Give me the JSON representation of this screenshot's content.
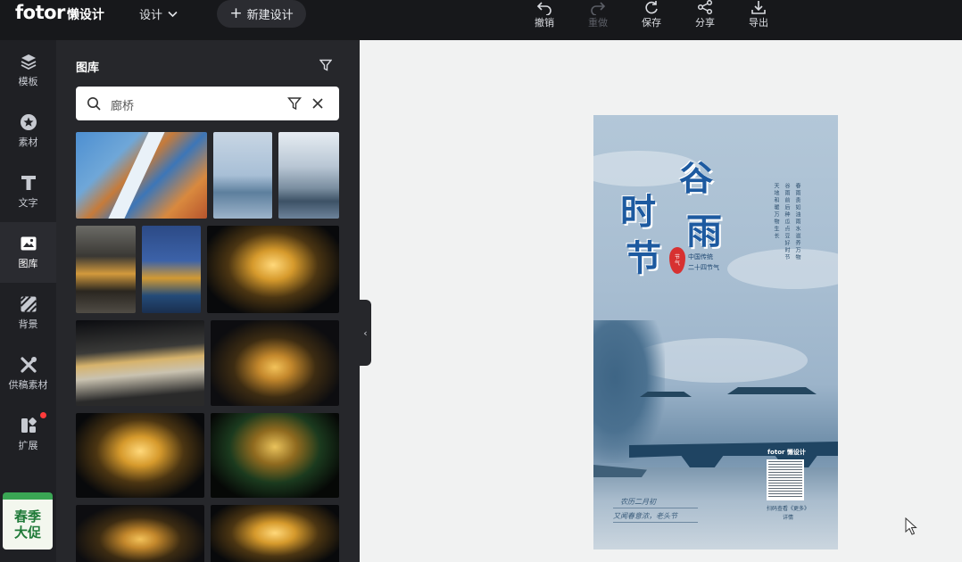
{
  "app": {
    "brand": "fotor",
    "product": "懒设计"
  },
  "header": {
    "design_menu": "设计",
    "new_design": "新建设计",
    "tools": [
      {
        "label": "撤销",
        "icon": "undo-icon",
        "enabled": true
      },
      {
        "label": "重做",
        "icon": "redo-icon",
        "enabled": false
      },
      {
        "label": "保存",
        "icon": "save-icon",
        "enabled": true
      },
      {
        "label": "分享",
        "icon": "share-icon",
        "enabled": true
      },
      {
        "label": "导出",
        "icon": "export-icon",
        "enabled": true
      }
    ]
  },
  "rail": {
    "items": [
      {
        "label": "模板",
        "icon": "layers-icon"
      },
      {
        "label": "素材",
        "icon": "star-icon"
      },
      {
        "label": "文字",
        "icon": "text-icon"
      },
      {
        "label": "图库",
        "icon": "image-icon",
        "active": true
      },
      {
        "label": "背景",
        "icon": "background-icon"
      },
      {
        "label": "供稿素材",
        "icon": "tools-icon"
      },
      {
        "label": "扩展",
        "icon": "extension-icon",
        "badge": true
      }
    ],
    "promo": {
      "line1": "春季",
      "line2": "大促"
    }
  },
  "panel": {
    "title": "图库",
    "search": {
      "value": "廊桥"
    }
  },
  "poster": {
    "title_chars": [
      "谷",
      "雨",
      "时",
      "节"
    ],
    "stamp_line1": "节",
    "stamp_line2": "气",
    "tag_line1": "中国传统",
    "tag_line2": "二十四节气",
    "footer_line1": "农历二月初",
    "footer_line2": "又闻春意浓，老头节",
    "qr_brand": "fotor 懒设计",
    "qr_caption": "扫码查看《更多》详情"
  },
  "colors": {
    "accent_blue": "#1d5aa0",
    "stamp_red": "#d73131",
    "promo_green": "#3aa654"
  }
}
